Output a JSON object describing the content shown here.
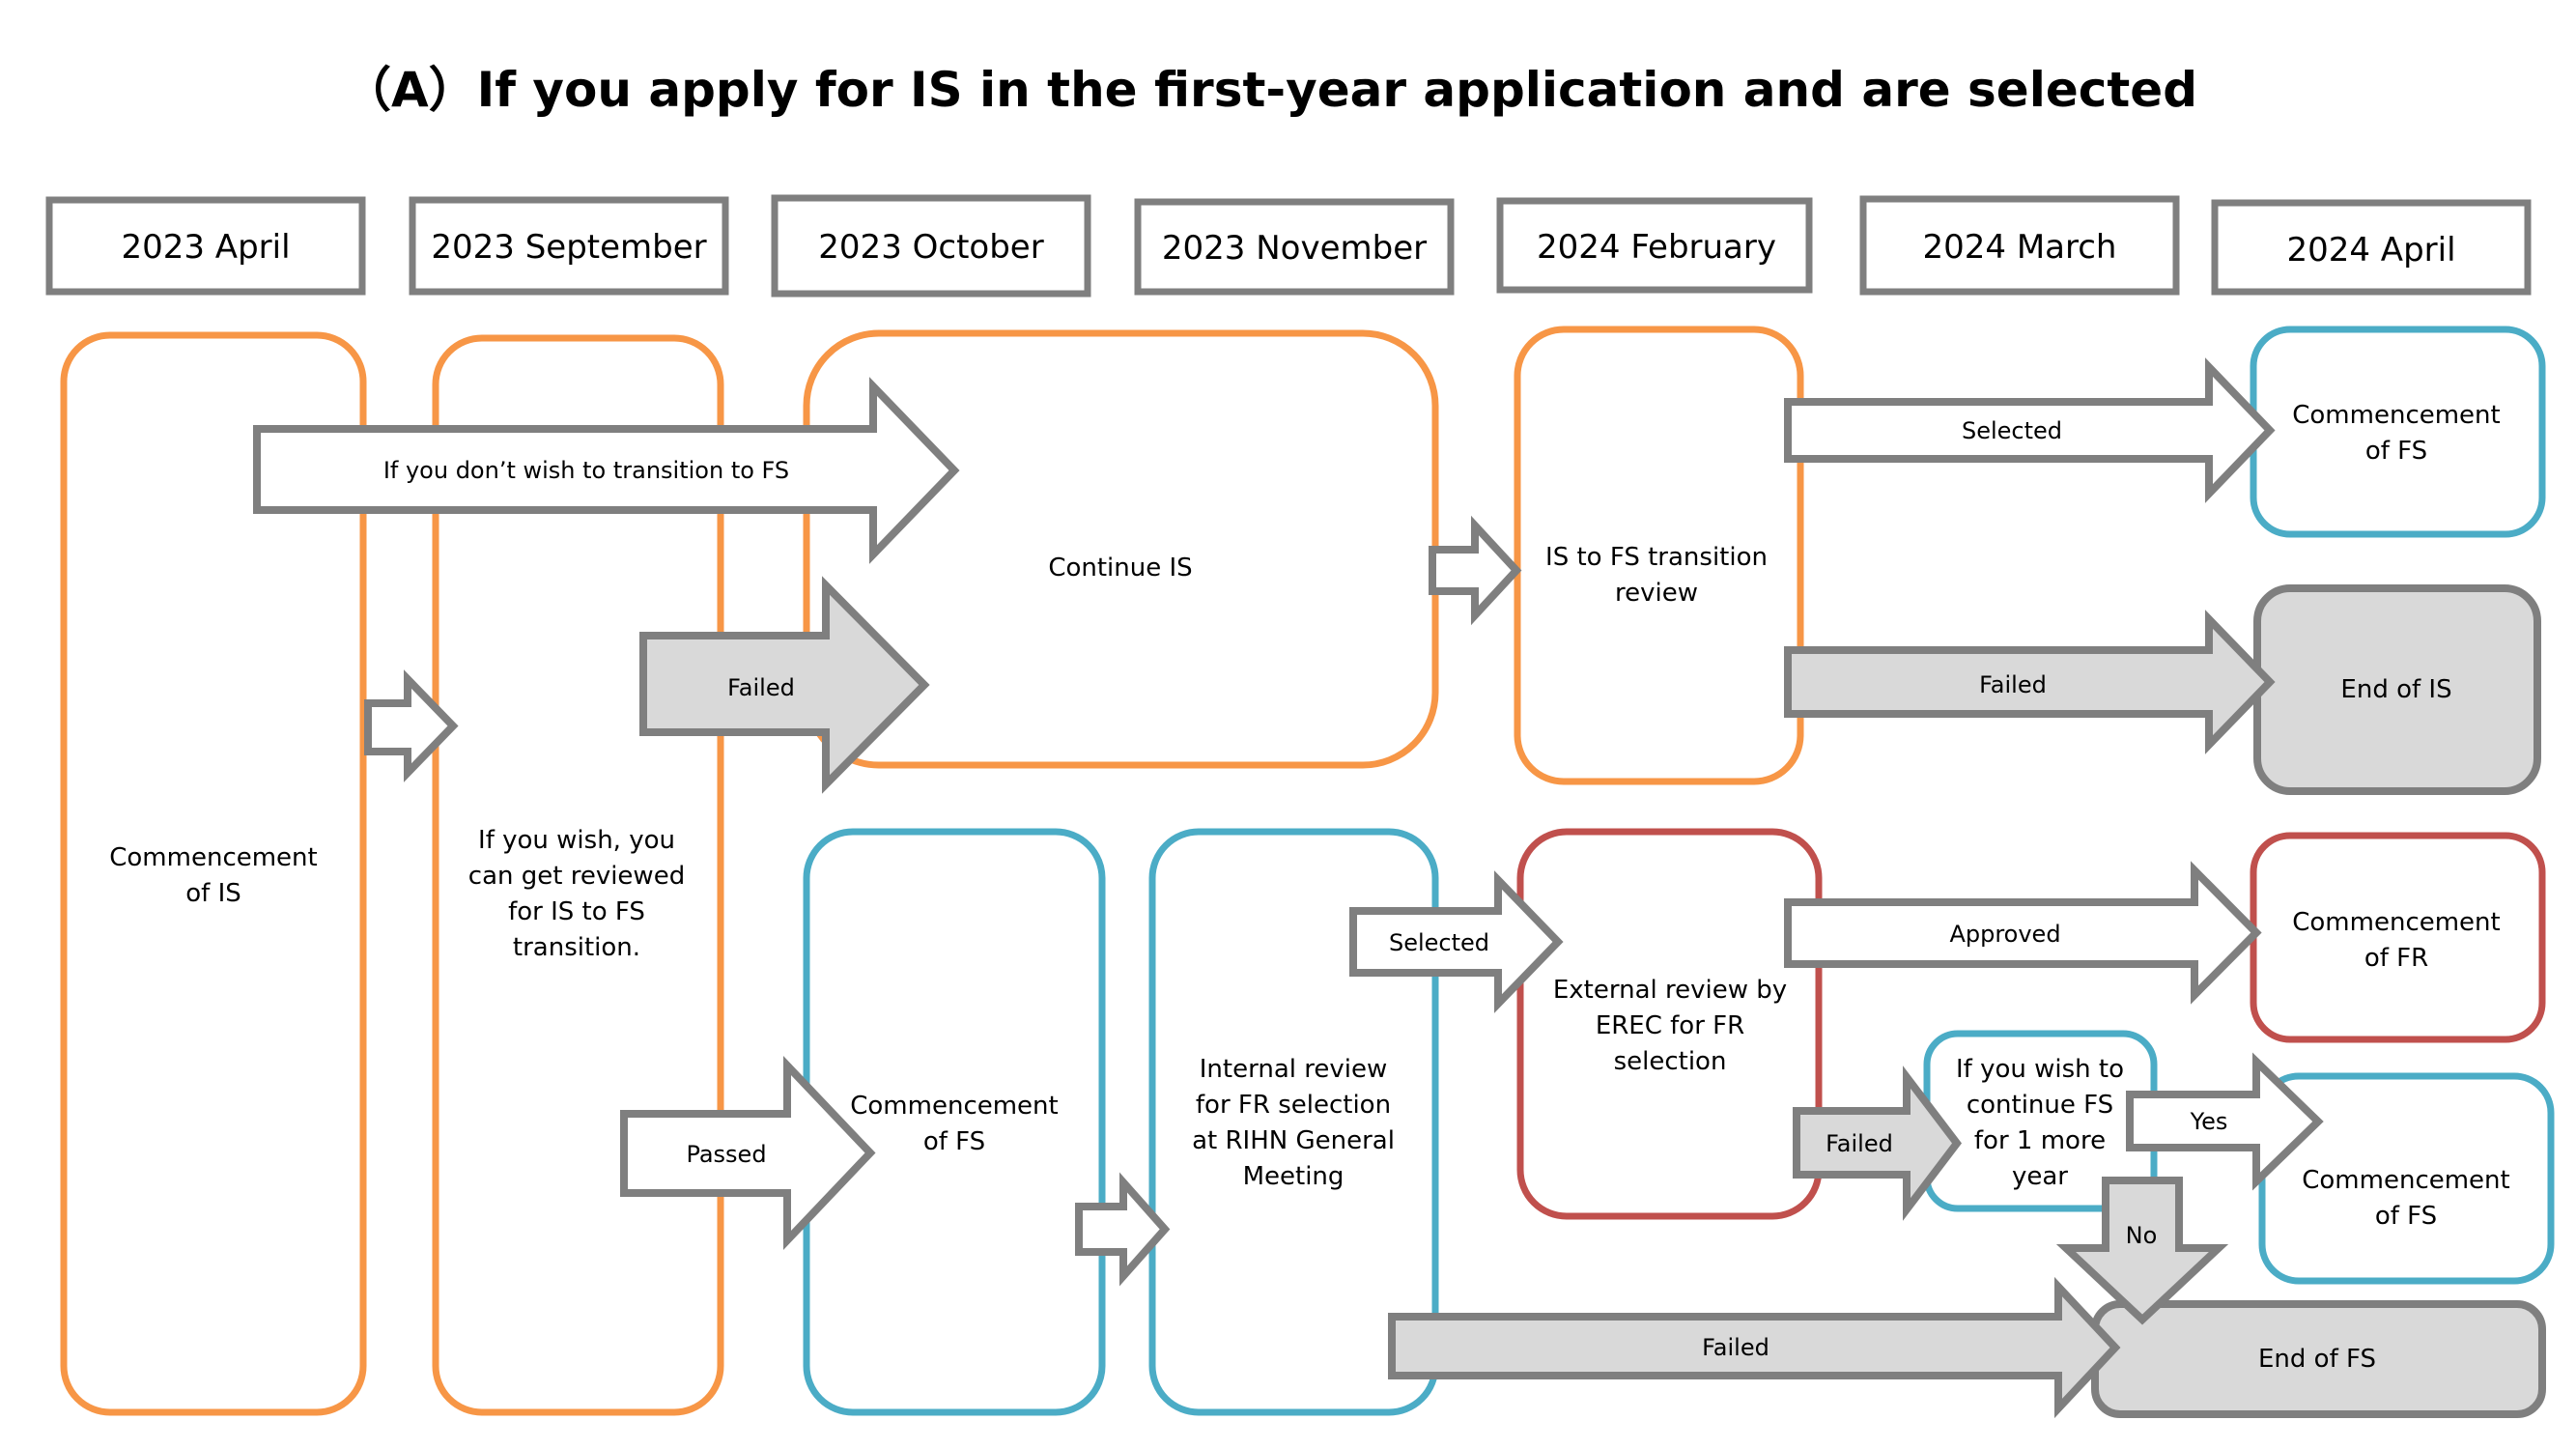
{
  "title": "（A）If you apply for IS in the first-year application and are selected",
  "timeline": [
    "2023 April",
    "2023 September",
    "2023 October",
    "2023 November",
    "2024 February",
    "2024 March",
    "2024 April"
  ],
  "boxes": {
    "commencement_is": [
      "Commencement",
      "of IS"
    ],
    "review_option": [
      "If you wish, you",
      "can get reviewed",
      "for  IS to FS",
      "transition."
    ],
    "continue_is": [
      "Continue IS"
    ],
    "transition_review": [
      "IS to FS transition",
      "review"
    ],
    "commencement_fs_top": [
      "Commencement",
      "of FS"
    ],
    "end_of_is": [
      "End of IS"
    ],
    "commencement_fs_mid": [
      "Commencement",
      "of FS"
    ],
    "internal_review": [
      "Internal review",
      "for FR selection",
      "at RIHN General",
      "Meeting"
    ],
    "external_review": [
      "External review by",
      "EREC for FR",
      "selection"
    ],
    "commencement_fr": [
      "Commencement",
      "of FR"
    ],
    "continue_fs_option": [
      "If you wish to",
      "continue FS",
      "for 1 more",
      "year"
    ],
    "commencement_fs_low": [
      "Commencement",
      "of FS"
    ],
    "end_of_fs": [
      "End of FS"
    ]
  },
  "arrows": {
    "no_transition": "If you don’t wish to transition to FS",
    "failed_to_continue": "Failed",
    "passed": "Passed",
    "selected_fs": "Selected",
    "failed_end_is": "Failed",
    "selected_fr": "Selected",
    "approved": "Approved",
    "failed_to_option": "Failed",
    "yes": "Yes",
    "no": "No",
    "failed_end_fs": "Failed"
  },
  "colors": {
    "is_stage": "#f79646",
    "fs_stage": "#4bacc6",
    "fr_stage": "#c0504d",
    "end_stage": "#d9d9d9",
    "connector": "#7f7f7f"
  }
}
